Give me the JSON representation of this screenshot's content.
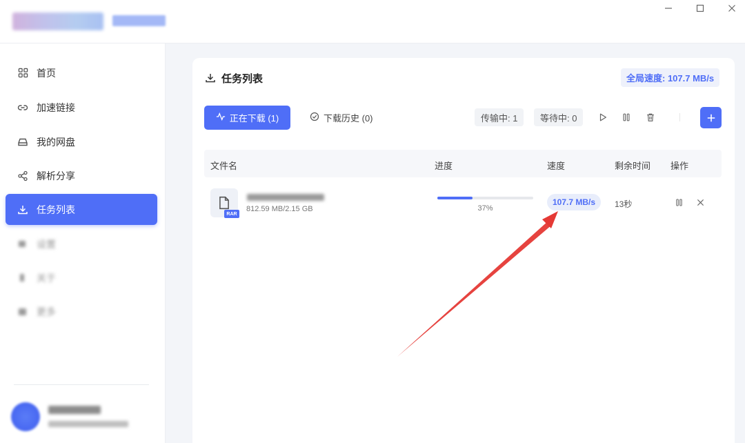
{
  "window": {
    "app_name": "Hyperdown",
    "version": "v1.0.0"
  },
  "sidebar": {
    "items": [
      {
        "label": "首页",
        "icon": "grid-icon"
      },
      {
        "label": "加速链接",
        "icon": "link-icon"
      },
      {
        "label": "我的网盘",
        "icon": "drive-icon"
      },
      {
        "label": "解析分享",
        "icon": "share-icon"
      },
      {
        "label": "任务列表",
        "icon": "download-icon",
        "active": true
      },
      {
        "label": "设置",
        "icon": "image-icon"
      },
      {
        "label": "关于",
        "icon": "person-icon"
      },
      {
        "label": "更多",
        "icon": "more-icon"
      }
    ],
    "user": {
      "name": "username",
      "subtitle": "user@example.com"
    }
  },
  "main": {
    "title": "任务列表",
    "global_speed": "全局速度: 107.7 MB/s",
    "tabs": {
      "downloading": "正在下载 (1)",
      "history": "下载历史 (0)"
    },
    "stats": {
      "transferring": "传输中: 1",
      "waiting": "等待中: 0"
    },
    "table": {
      "headers": {
        "name": "文件名",
        "progress": "进度",
        "speed": "速度",
        "remaining": "剩余时间",
        "actions": "操作"
      },
      "rows": [
        {
          "name": "filename.rar",
          "type_badge": "RAR",
          "size": "812.59 MB/2.15 GB",
          "progress_fraction": 0.37,
          "progress_label": "37%",
          "speed": "107.7 MB/s",
          "remaining": "13秒"
        }
      ]
    }
  },
  "colors": {
    "accent": "#4f6ef7",
    "annotation_arrow": "#e53935"
  }
}
